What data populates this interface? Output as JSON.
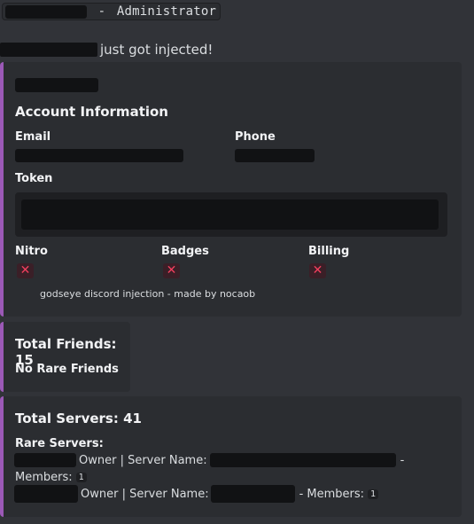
{
  "header": {
    "separator": "-",
    "role": "Administrator"
  },
  "message": {
    "injected_text": "just got injected!"
  },
  "account_embed": {
    "title": "Account Information",
    "fields": {
      "email_label": "Email",
      "phone_label": "Phone",
      "token_label": "Token",
      "nitro_label": "Nitro",
      "badges_label": "Badges",
      "billing_label": "Billing"
    },
    "nitro_value_icon": "cross-mark-icon",
    "badges_value_icon": "cross-mark-icon",
    "billing_value_icon": "cross-mark-icon",
    "x_glyph": "✕",
    "footer": "godseye discord injection - made by nocaob"
  },
  "friends_embed": {
    "title": "Total Friends: 15",
    "subtitle": "No Rare Friends"
  },
  "servers_embed": {
    "title": "Total Servers: 41",
    "rare_label": "Rare Servers:",
    "owner_text": "Owner | Server Name:",
    "members_dash": "-",
    "members_label": "Members:",
    "members_dash_label": "- Members:",
    "server1_members": "1",
    "server2_members": "1"
  },
  "colors": {
    "background": "#313338",
    "embed_bg": "#2b2d31",
    "accent": "#9b59b6",
    "redaction": "#111214",
    "cross": "#f23f5e"
  }
}
